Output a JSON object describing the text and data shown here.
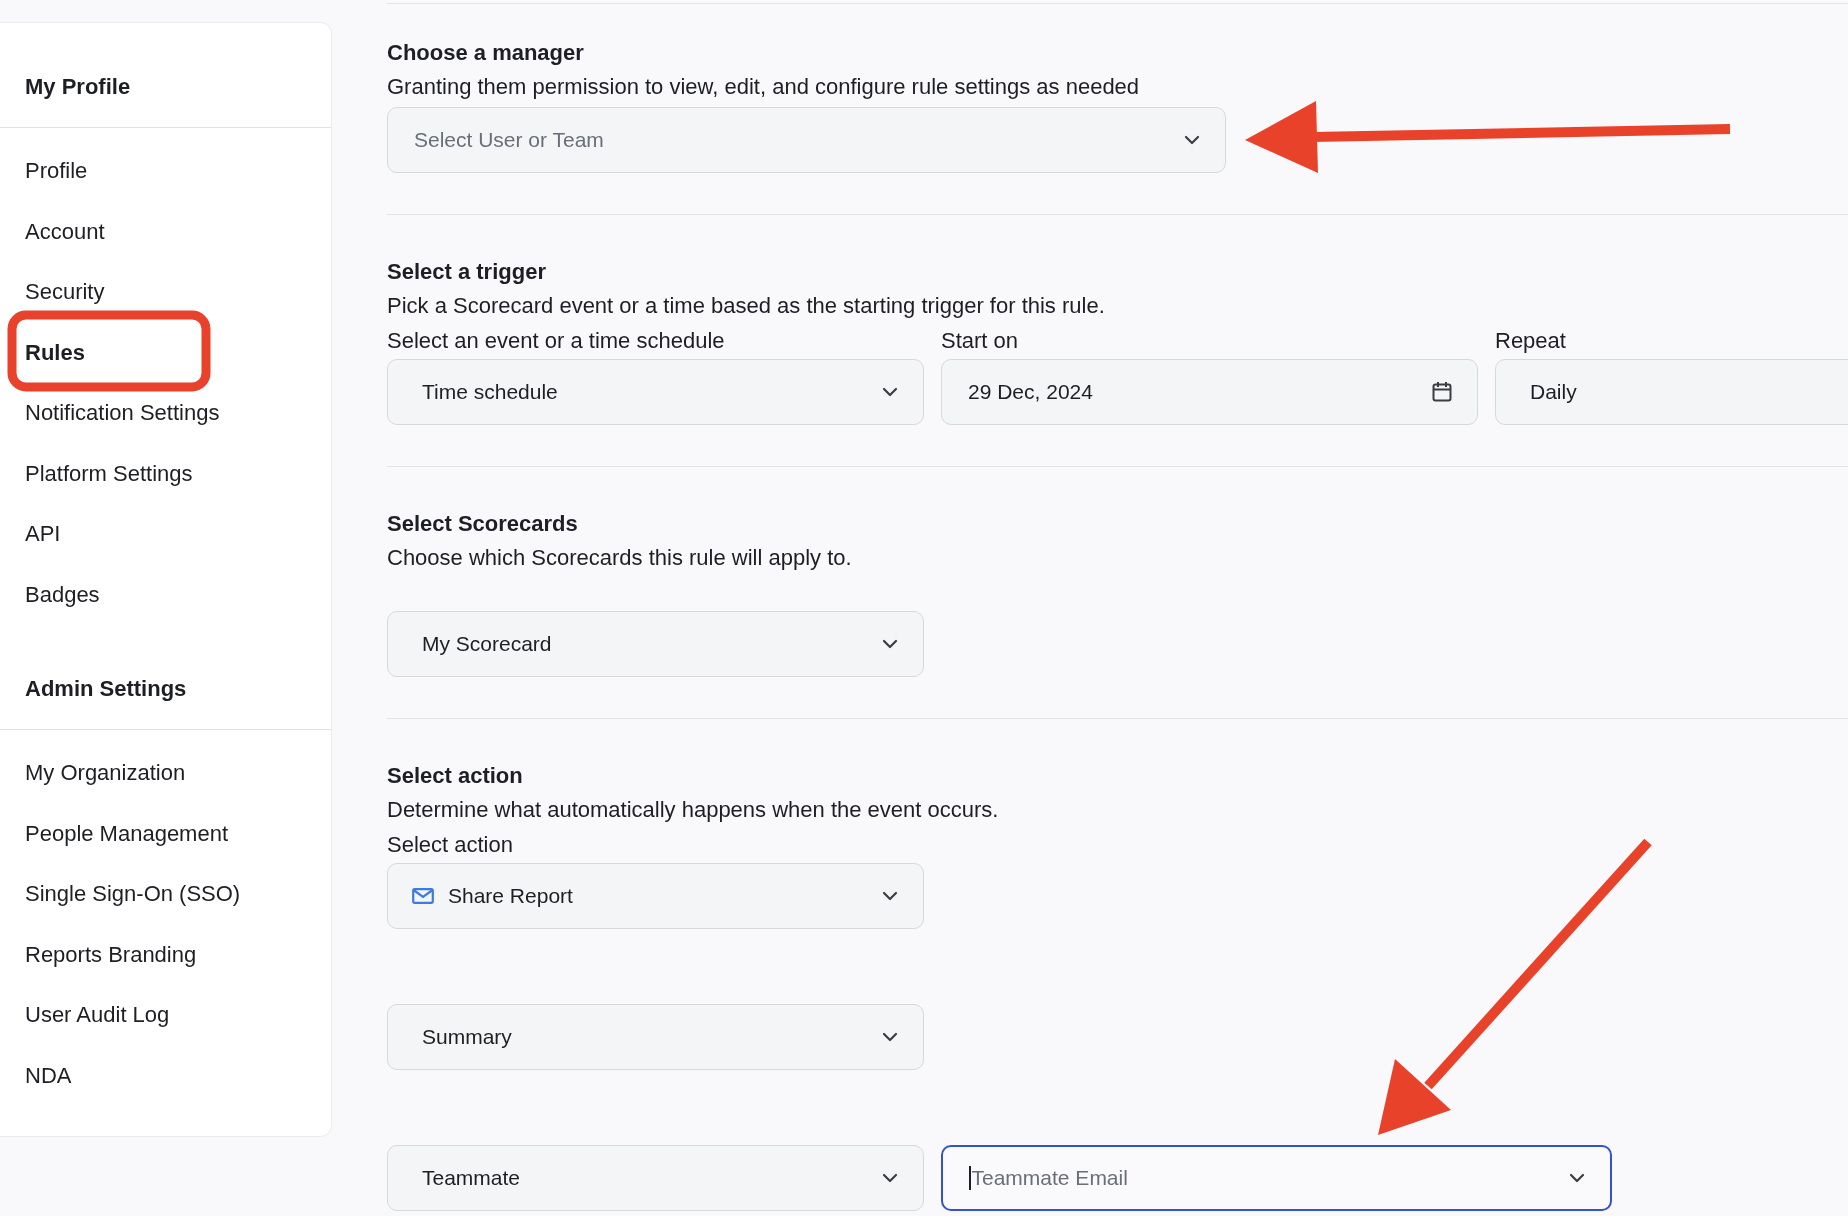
{
  "sidebar": {
    "groups": [
      {
        "title": "My Profile",
        "items": [
          {
            "label": "Profile",
            "selected": false
          },
          {
            "label": "Account",
            "selected": false
          },
          {
            "label": "Security",
            "selected": false
          },
          {
            "label": "Rules",
            "selected": true
          },
          {
            "label": "Notification Settings",
            "selected": false
          },
          {
            "label": "Platform Settings",
            "selected": false
          },
          {
            "label": "API",
            "selected": false
          },
          {
            "label": "Badges",
            "selected": false
          }
        ]
      },
      {
        "title": "Admin Settings",
        "items": [
          {
            "label": "My Organization",
            "selected": false
          },
          {
            "label": "People Management",
            "selected": false
          },
          {
            "label": "Single Sign-On (SSO)",
            "selected": false
          },
          {
            "label": "Reports Branding",
            "selected": false
          },
          {
            "label": "User Audit Log",
            "selected": false
          },
          {
            "label": "NDA",
            "selected": false
          }
        ]
      }
    ]
  },
  "sections": [
    {
      "title": "Choose a manager",
      "description": "Granting them permission to view, edit, and configure rule settings as needed",
      "rows": [
        [
          {
            "kind": "select",
            "placeholder": "Select User or Team",
            "focused": false
          }
        ]
      ]
    },
    {
      "title": "Select a trigger",
      "description": "Pick a Scorecard event or a time based as the starting trigger for this rule.",
      "rows": [
        [
          {
            "kind": "select",
            "label": "Select an event or a time schedule",
            "value": "Time schedule",
            "focused": false
          },
          {
            "kind": "date",
            "label": "Start on",
            "value": "29 Dec, 2024",
            "focused": false
          },
          {
            "kind": "text",
            "label": "Repeat",
            "value": "Daily",
            "focused": false
          }
        ]
      ]
    },
    {
      "title": "Select Scorecards",
      "description": "Choose which Scorecards this rule will apply to.",
      "rows": [
        [
          {
            "kind": "select",
            "value": "My Scorecard",
            "focused": false
          }
        ]
      ]
    },
    {
      "title": "Select action",
      "description": "Determine what automatically happens when the event occurs.",
      "rows": [
        [
          {
            "kind": "mail-select",
            "label": "Select action",
            "value": "Share Report",
            "focused": false
          }
        ],
        [
          {
            "kind": "select",
            "value": "Summary",
            "focused": false
          }
        ],
        [
          {
            "kind": "select",
            "value": "Teammate",
            "focused": false
          },
          {
            "kind": "select",
            "placeholder": "Teammate Email",
            "focused": true
          }
        ]
      ]
    }
  ],
  "annotations": [
    {
      "kind": "highlight"
    },
    {
      "kind": "arrow"
    },
    {
      "kind": "arrow"
    }
  ]
}
